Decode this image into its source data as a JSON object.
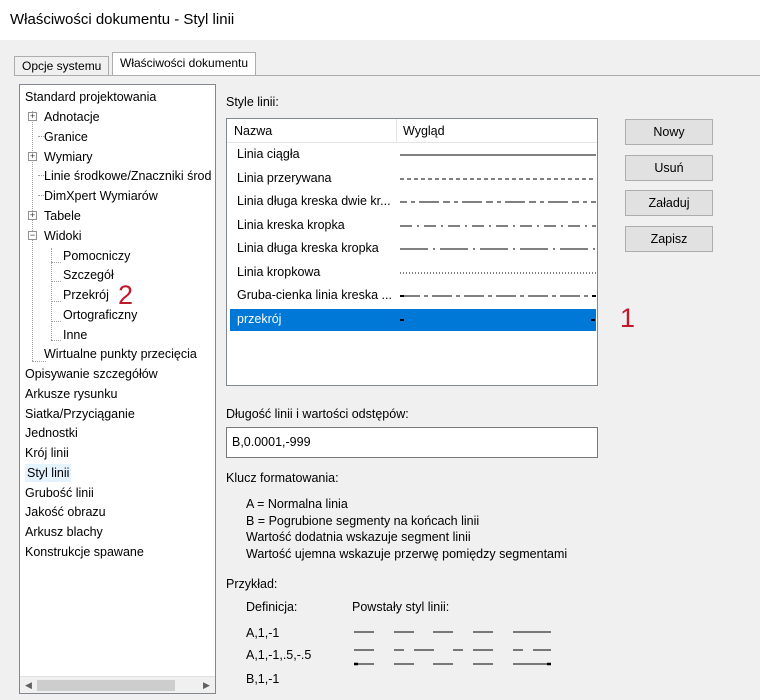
{
  "window": {
    "title": "Właściwości dokumentu - Styl linii"
  },
  "tabs": [
    {
      "label": "Opcje systemu"
    },
    {
      "label": "Właściwości dokumentu"
    }
  ],
  "tree": {
    "items": [
      {
        "label": "Standard projektowania"
      },
      {
        "label": "Adnotacje"
      },
      {
        "label": "Granice"
      },
      {
        "label": "Wymiary"
      },
      {
        "label": "Linie środkowe/Znaczniki środ"
      },
      {
        "label": "DimXpert Wymiarów"
      },
      {
        "label": "Tabele"
      },
      {
        "label": "Widoki"
      },
      {
        "label": "Pomocniczy"
      },
      {
        "label": "Szczegół"
      },
      {
        "label": "Przekrój"
      },
      {
        "label": "Ortograficzny"
      },
      {
        "label": "Inne"
      },
      {
        "label": "Wirtualne punkty przecięcia"
      },
      {
        "label": "Opisywanie szczegółów"
      },
      {
        "label": "Arkusze rysunku"
      },
      {
        "label": "Siatka/Przyciąganie"
      },
      {
        "label": "Jednostki"
      },
      {
        "label": "Krój linii"
      },
      {
        "label": "Styl linii"
      },
      {
        "label": "Grubość linii"
      },
      {
        "label": "Jakość obrazu"
      },
      {
        "label": "Arkusz blachy"
      },
      {
        "label": "Konstrukcje spawane"
      }
    ],
    "selected": "Styl linii",
    "expand_plus": "+",
    "expand_minus": "−",
    "scroll_left": "◀",
    "scroll_right": "▶"
  },
  "line_styles": {
    "label": "Style linii:",
    "col_name": "Nazwa",
    "col_look": "Wygląd",
    "rows": [
      {
        "name": "Linia ciągła",
        "pattern": "solid"
      },
      {
        "name": "Linia przerywana",
        "pattern": "dashed"
      },
      {
        "name": "Linia długa kreska dwie kr...",
        "pattern": "long-two-short"
      },
      {
        "name": "Linia kreska kropka",
        "pattern": "dash-dot"
      },
      {
        "name": "Linia długa kreska kropka",
        "pattern": "long-dash-dot"
      },
      {
        "name": "Linia kropkowa",
        "pattern": "dotted"
      },
      {
        "name": "Gruba-cienka linia kreska ...",
        "pattern": "thick-thin"
      },
      {
        "name": "przekrój",
        "pattern": "section",
        "selected": true
      }
    ]
  },
  "buttons": {
    "new": "Nowy",
    "delete": "Usuń",
    "load": "Załaduj",
    "save": "Zapisz"
  },
  "length": {
    "label": "Długość linii i wartości odstępów:",
    "value": "B,0.0001,-999"
  },
  "format_key": {
    "label": "Klucz formatowania:",
    "lines": [
      "A = Normalna linia",
      "B = Pogrubione segmenty na końcach linii",
      "Wartość dodatnia wskazuje segment linii",
      "Wartość ujemna wskazuje przerwę pomiędzy segmentami"
    ]
  },
  "example": {
    "label": "Przykład:",
    "col_def": "Definicja:",
    "col_result": "Powstały styl linii:",
    "rows": [
      {
        "def": "A,1,-1"
      },
      {
        "def": "A,1,-1,.5,-.5"
      },
      {
        "def": "B,1,-1"
      }
    ]
  },
  "annotations": {
    "one": "1",
    "two": "2"
  },
  "colors": {
    "selection": "#0078d7",
    "annotation": "#c0192a"
  }
}
